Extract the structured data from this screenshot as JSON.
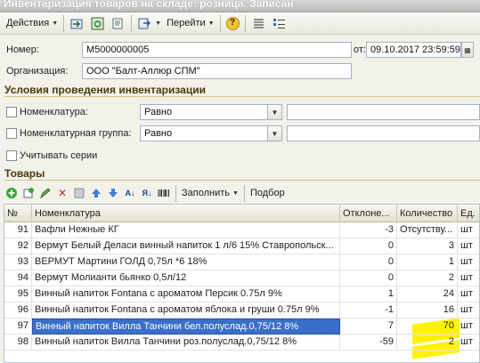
{
  "window": {
    "title": "Инвентаризация товаров на складе: розница. Записан"
  },
  "toolbar": {
    "actions_label": "Действия",
    "goto_label": "Перейти",
    "help_label": "?"
  },
  "header": {
    "number_label": "Номер:",
    "number_value": "М5000000005",
    "date_label": "от:",
    "date_value": "09.10.2017 23:59:59",
    "org_label": "Организация:",
    "org_value": "ООО \"Балт-Аллюр СПМ\""
  },
  "conditions": {
    "title": "Условия проведения инвентаризации",
    "nomenclature_label": "Номенклатура:",
    "nomenclature_op": "Равно",
    "group_label": "Номенклатурная группа:",
    "group_op": "Равно",
    "series_label": "Учитывать серии"
  },
  "goods": {
    "title": "Товары",
    "fill_label": "Заполнить",
    "select_label": "Подбор",
    "columns": {
      "n": "№",
      "name": "Номенклатура",
      "dev": "Отклоне...",
      "qty": "Количество",
      "unit": "Ед."
    },
    "rows": [
      {
        "n": "91",
        "name": "Вафли Нежные КГ",
        "dev": "-3",
        "qty": "Отсутству...",
        "unit": "шт"
      },
      {
        "n": "92",
        "name": "Вермут Белый Деласи винный напиток 1 л/6 15% Ставропольск...",
        "dev": "0",
        "qty": "3",
        "unit": "шт"
      },
      {
        "n": "93",
        "name": "ВЕРМУТ Мартини ГОЛД 0,75л *6 18%",
        "dev": "0",
        "qty": "1",
        "unit": "шт"
      },
      {
        "n": "94",
        "name": "Вермут Молианти бьянко 0,5л/12",
        "dev": "0",
        "qty": "2",
        "unit": "шт"
      },
      {
        "n": "95",
        "name": "Винный напиток Fontana с ароматом Персик 0.75л 9%",
        "dev": "1",
        "qty": "24",
        "unit": "шт"
      },
      {
        "n": "96",
        "name": "Винный напиток Fontana с ароматом яблока и груши 0.75л 9%",
        "dev": "-1",
        "qty": "16",
        "unit": "шт"
      },
      {
        "n": "97",
        "name": "Винный напиток Вилла Танчини бел.полуслад.0,75/12 8%",
        "dev": "7",
        "qty": "70",
        "unit": "шт",
        "selected": true
      },
      {
        "n": "98",
        "name": "Винный напиток Вилла Танчини роз.полуслад.0,75/12 8%",
        "dev": "-59",
        "qty": "2",
        "unit": "шт"
      }
    ]
  },
  "colors": {
    "selection": "#3a6fc9",
    "highlight": "#fff200",
    "section_title": "#4a3a0b"
  }
}
